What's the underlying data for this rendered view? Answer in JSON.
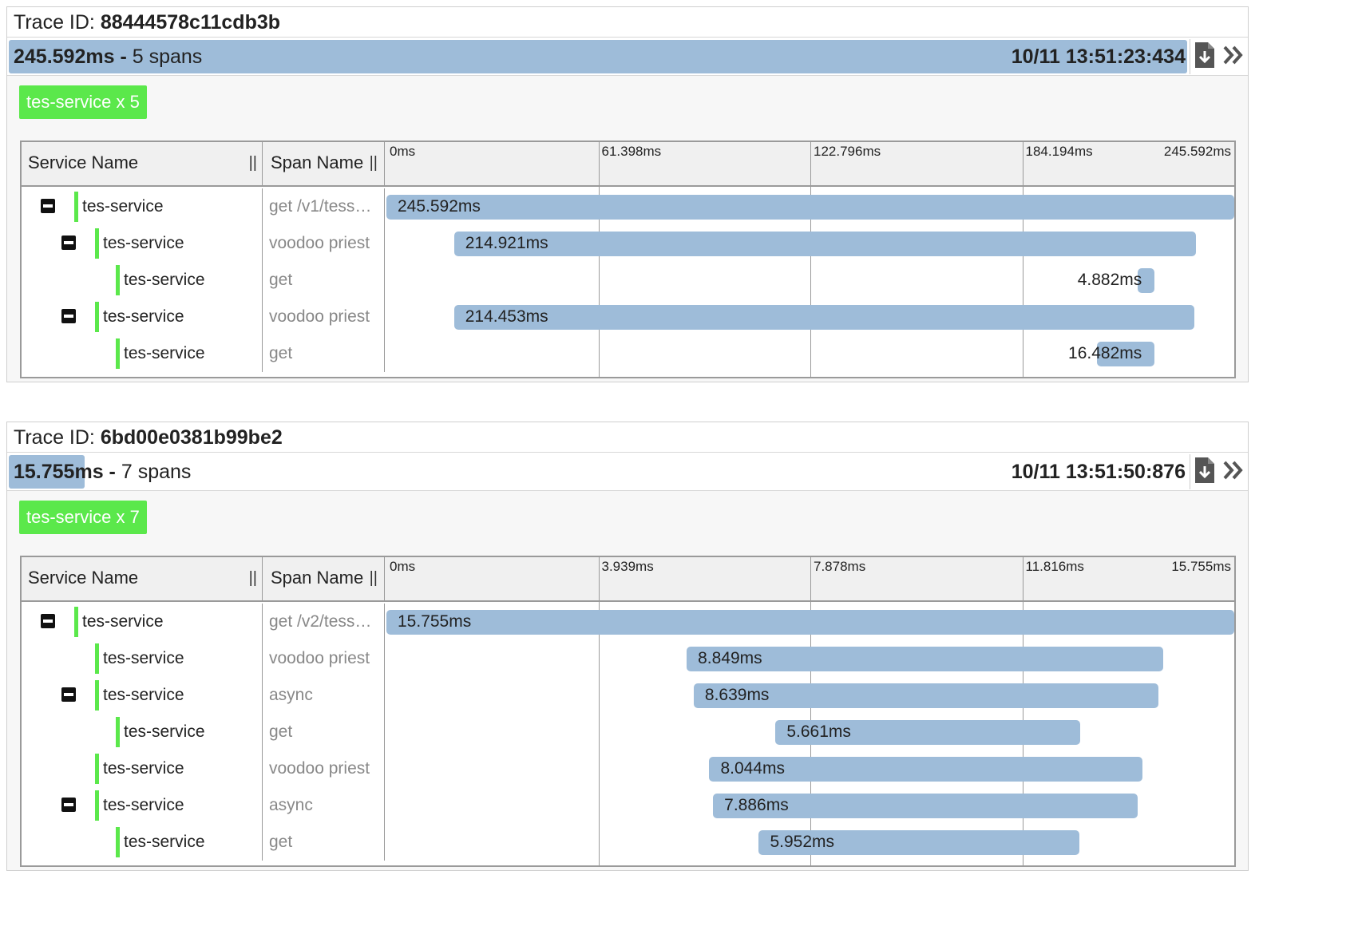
{
  "trace_id_label": "Trace ID:",
  "spans_suffix": "spans",
  "traces": [
    {
      "trace_id": "88444578c11cdb3b",
      "duration": "245.592ms",
      "span_count": "5",
      "timestamp": "10/11 13:51:23:434",
      "duration_fraction": 1.0,
      "service_badge": "tes-service x 5",
      "headers": {
        "service": "Service Name",
        "span": "Span Name",
        "resize": "||"
      },
      "ticks": [
        "0ms",
        "61.398ms",
        "122.796ms",
        "184.194ms",
        "245.592ms"
      ],
      "total_ms": 245.592,
      "rows": [
        {
          "service": "tes-service",
          "span": "get /v1/tess…",
          "depth": 0,
          "toggle": true,
          "start_ms": 0,
          "duration_ms": 245.592,
          "label": "245.592ms"
        },
        {
          "service": "tes-service",
          "span": "voodoo priest",
          "depth": 1,
          "toggle": true,
          "start_ms": 19.6,
          "duration_ms": 214.921,
          "label": "214.921ms"
        },
        {
          "service": "tes-service",
          "span": "get",
          "depth": 2,
          "toggle": false,
          "start_ms": 217.5,
          "duration_ms": 4.882,
          "label": "4.882ms"
        },
        {
          "service": "tes-service",
          "span": "voodoo priest",
          "depth": 1,
          "toggle": true,
          "start_ms": 19.6,
          "duration_ms": 214.453,
          "label": "214.453ms"
        },
        {
          "service": "tes-service",
          "span": "get",
          "depth": 2,
          "toggle": false,
          "start_ms": 205.9,
          "duration_ms": 16.482,
          "label": "16.482ms"
        }
      ]
    },
    {
      "trace_id": "6bd00e0381b99be2",
      "duration": "15.755ms",
      "span_count": "7",
      "timestamp": "10/11 13:51:50:876",
      "duration_fraction": 0.0641,
      "service_badge": "tes-service x 7",
      "headers": {
        "service": "Service Name",
        "span": "Span Name",
        "resize": "||"
      },
      "ticks": [
        "0ms",
        "3.939ms",
        "7.878ms",
        "11.816ms",
        "15.755ms"
      ],
      "total_ms": 15.755,
      "rows": [
        {
          "service": "tes-service",
          "span": "get /v2/tess…",
          "depth": 0,
          "toggle": true,
          "start_ms": 0,
          "duration_ms": 15.755,
          "label": "15.755ms"
        },
        {
          "service": "tes-service",
          "span": "voodoo priest",
          "depth": 1,
          "toggle": false,
          "start_ms": 5.58,
          "duration_ms": 8.849,
          "label": "8.849ms"
        },
        {
          "service": "tes-service",
          "span": "async",
          "depth": 1,
          "toggle": true,
          "start_ms": 5.71,
          "duration_ms": 8.639,
          "label": "8.639ms"
        },
        {
          "service": "tes-service",
          "span": "get",
          "depth": 2,
          "toggle": false,
          "start_ms": 7.23,
          "duration_ms": 5.661,
          "label": "5.661ms"
        },
        {
          "service": "tes-service",
          "span": "voodoo priest",
          "depth": 1,
          "toggle": false,
          "start_ms": 6.0,
          "duration_ms": 8.044,
          "label": "8.044ms"
        },
        {
          "service": "tes-service",
          "span": "async",
          "depth": 1,
          "toggle": true,
          "start_ms": 6.07,
          "duration_ms": 7.886,
          "label": "7.886ms"
        },
        {
          "service": "tes-service",
          "span": "get",
          "depth": 2,
          "toggle": false,
          "start_ms": 6.92,
          "duration_ms": 5.952,
          "label": "5.952ms"
        }
      ]
    }
  ],
  "icons": {
    "download": "file-download-icon",
    "expand": "double-chevron-right-icon"
  }
}
